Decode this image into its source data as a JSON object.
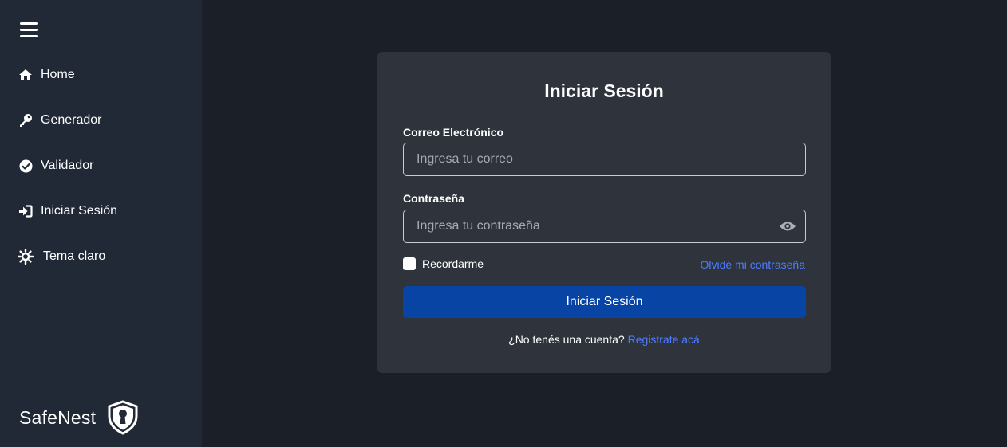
{
  "sidebar": {
    "items": [
      {
        "label": "Home",
        "icon": "home-icon"
      },
      {
        "label": "Generador",
        "icon": "key-icon"
      },
      {
        "label": "Validador",
        "icon": "check-circle-icon"
      },
      {
        "label": "Iniciar Sesión",
        "icon": "sign-in-icon"
      },
      {
        "label": "Tema claro",
        "icon": "sun-icon"
      }
    ],
    "brand": "SafeNest"
  },
  "login": {
    "title": "Iniciar Sesión",
    "email_label": "Correo Electrónico",
    "email_placeholder": "Ingresa tu correo",
    "email_value": "",
    "password_label": "Contraseña",
    "password_placeholder": "Ingresa tu contraseña",
    "password_value": "",
    "remember_label": "Recordarme",
    "remember_checked": false,
    "forgot_link": "Olvidé mi contraseña",
    "submit_label": "Iniciar Sesión",
    "signup_prompt": "¿No tenés una cuenta?",
    "signup_link": "Registrate acá"
  },
  "colors": {
    "background": "#1b1f27",
    "sidebar": "#212836",
    "card": "#2e333c",
    "primary_button": "#0844a3",
    "link": "#4d7dff"
  }
}
